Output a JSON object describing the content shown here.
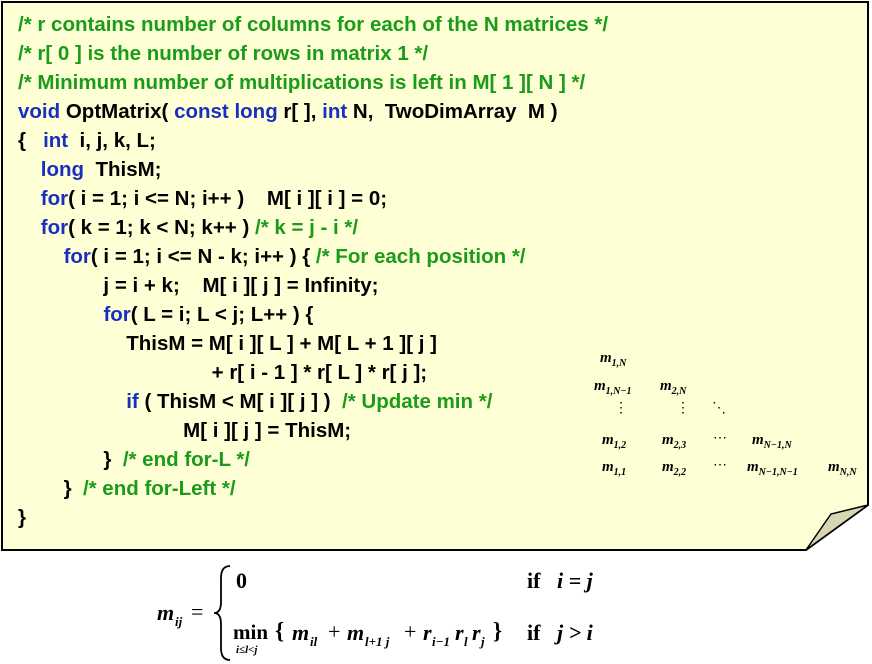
{
  "colors": {
    "note_fill": "#ffffd6",
    "comment": "#1a9c1a",
    "keyword": "#1a2fc0",
    "text": "#000000"
  },
  "code_lines": [
    [
      {
        "t": "/* r contains number of columns for each of the N matrices */",
        "c": "cm"
      }
    ],
    [
      {
        "t": "/* r[ 0 ] is the number of rows in matrix 1 */",
        "c": "cm"
      }
    ],
    [
      {
        "t": "/* Minimum number of multiplications is left in M[ 1 ][ N ] */",
        "c": "cm"
      }
    ],
    [
      {
        "t": "void",
        "c": "kw"
      },
      {
        "t": " OptMatrix( "
      },
      {
        "t": "const",
        "c": "kw"
      },
      {
        "t": " "
      },
      {
        "t": "long",
        "c": "kw"
      },
      {
        "t": " r[ ], "
      },
      {
        "t": "int",
        "c": "kw"
      },
      {
        "t": " N,  TwoDimArray  M )"
      }
    ],
    [
      {
        "t": "{   "
      },
      {
        "t": "int",
        "c": "kw"
      },
      {
        "t": "  i, j, k, L;"
      }
    ],
    [
      {
        "t": "    "
      },
      {
        "t": "long",
        "c": "kw"
      },
      {
        "t": "  ThisM;"
      }
    ],
    [
      {
        "t": "    "
      },
      {
        "t": "for",
        "c": "kw"
      },
      {
        "t": "( i = 1; i <= N; i++ )    M[ i ][ i ] = 0;"
      }
    ],
    [
      {
        "t": "    "
      },
      {
        "t": "for",
        "c": "kw"
      },
      {
        "t": "( k = 1; k < N; k++ ) "
      },
      {
        "t": "/* k = j - i */",
        "c": "cm"
      }
    ],
    [
      {
        "t": "        "
      },
      {
        "t": "for",
        "c": "kw"
      },
      {
        "t": "( i = 1; i <= N - k; i++ ) { "
      },
      {
        "t": "/* For each position */",
        "c": "cm"
      }
    ],
    [
      {
        "t": "               j = i + k;    M[ i ][ j ] = Infinity;"
      }
    ],
    [
      {
        "t": "               "
      },
      {
        "t": "for",
        "c": "kw"
      },
      {
        "t": "( L = i; L < j; L++ ) {"
      }
    ],
    [
      {
        "t": "                   ThisM = M[ i ][ L ] + M[ L + 1 ][ j ]"
      }
    ],
    [
      {
        "t": "                                  + r[ i - 1 ] * r[ L ] * r[ j ];"
      }
    ],
    [
      {
        "t": "                   "
      },
      {
        "t": "if",
        "c": "kw"
      },
      {
        "t": " ( ThisM < M[ i ][ j ] )  "
      },
      {
        "t": "/* Update min */",
        "c": "cm"
      }
    ],
    [
      {
        "t": "                             M[ i ][ j ] = ThisM;"
      }
    ],
    [
      {
        "t": "               }  "
      },
      {
        "t": "/* end for-L */",
        "c": "cm"
      }
    ],
    [
      {
        "t": "        }  "
      },
      {
        "t": "/* end for-Left */",
        "c": "cm"
      }
    ],
    [
      {
        "t": "}"
      }
    ]
  ],
  "matrix_labels": {
    "m1N": {
      "b": "m",
      "s": "1,N"
    },
    "m1N1": {
      "b": "m",
      "s": "1,N−1"
    },
    "m2N": {
      "b": "m",
      "s": "2,N"
    },
    "m12": {
      "b": "m",
      "s": "1,2"
    },
    "m23": {
      "b": "m",
      "s": "2,3"
    },
    "mN1N": {
      "b": "m",
      "s": "N−1,N"
    },
    "m11": {
      "b": "m",
      "s": "1,1"
    },
    "m22": {
      "b": "m",
      "s": "2,2"
    },
    "mN1N1": {
      "b": "m",
      "s": "N−1,N−1"
    },
    "mNN": {
      "b": "m",
      "s": "N,N"
    },
    "vdots": "⋮",
    "ddots": "⋱",
    "cdots": "⋯"
  },
  "formula": {
    "lhs": "m",
    "lhs_sub": "ij",
    "eq": "=",
    "case1_value": "0",
    "case1_cond_if": "if",
    "case1_cond": "i = j",
    "case2_min": "min",
    "case2_min_sub": "i≤l<j",
    "case2_expr_open": "{",
    "case2_m1": "m",
    "case2_m1_sub": "il",
    "plus1": "+",
    "case2_m2": "m",
    "case2_m2_sub": "l+1 j",
    "plus2": "+",
    "case2_r1": "r",
    "case2_r1_sub": "i−1",
    "case2_r2": "r",
    "case2_r2_sub": "l",
    "case2_r3": "r",
    "case2_r3_sub": "j",
    "case2_expr_close": "}",
    "case2_cond_if": "if",
    "case2_cond": "j > i"
  }
}
